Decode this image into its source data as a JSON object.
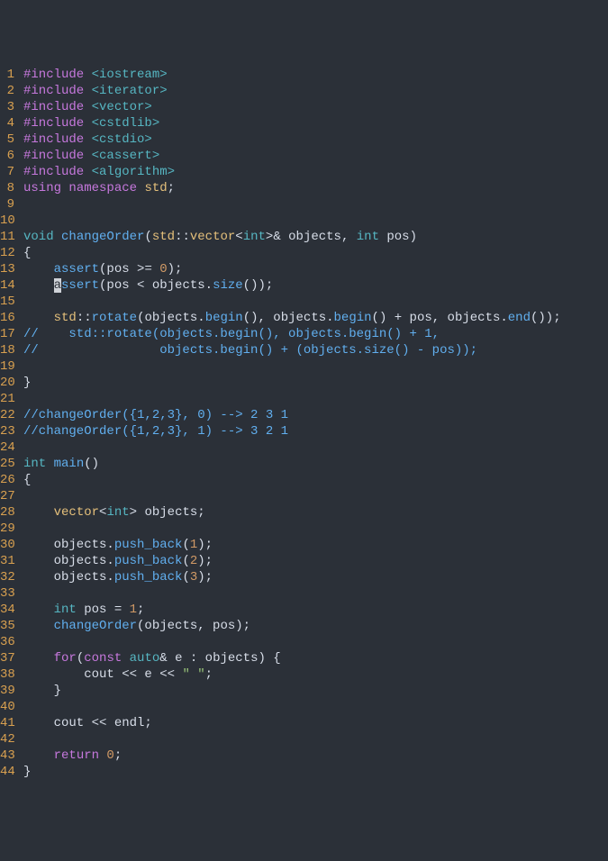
{
  "file": {
    "language": "cpp",
    "cursor": {
      "line": 14,
      "col": 5
    },
    "lines": [
      {
        "num": 1,
        "tokens": [
          {
            "t": "#include ",
            "c": "pp"
          },
          {
            "t": "<iostream>",
            "c": "inc"
          }
        ]
      },
      {
        "num": 2,
        "tokens": [
          {
            "t": "#include ",
            "c": "pp"
          },
          {
            "t": "<iterator>",
            "c": "inc"
          }
        ]
      },
      {
        "num": 3,
        "tokens": [
          {
            "t": "#include ",
            "c": "pp"
          },
          {
            "t": "<vector>",
            "c": "inc"
          }
        ]
      },
      {
        "num": 4,
        "tokens": [
          {
            "t": "#include ",
            "c": "pp"
          },
          {
            "t": "<cstdlib>",
            "c": "inc"
          }
        ]
      },
      {
        "num": 5,
        "tokens": [
          {
            "t": "#include ",
            "c": "pp"
          },
          {
            "t": "<cstdio>",
            "c": "inc"
          }
        ]
      },
      {
        "num": 6,
        "tokens": [
          {
            "t": "#include ",
            "c": "pp"
          },
          {
            "t": "<cassert>",
            "c": "inc"
          }
        ]
      },
      {
        "num": 7,
        "tokens": [
          {
            "t": "#include ",
            "c": "pp"
          },
          {
            "t": "<algorithm>",
            "c": "inc"
          }
        ]
      },
      {
        "num": 8,
        "tokens": [
          {
            "t": "using ",
            "c": "kw"
          },
          {
            "t": "namespace ",
            "c": "kw"
          },
          {
            "t": "std",
            "c": "ylw"
          },
          {
            "t": ";",
            "c": "pu"
          }
        ]
      },
      {
        "num": 9,
        "tokens": []
      },
      {
        "num": 10,
        "tokens": []
      },
      {
        "num": 11,
        "tokens": [
          {
            "t": "void ",
            "c": "ty"
          },
          {
            "t": "changeOrder",
            "c": "fn"
          },
          {
            "t": "(",
            "c": "pu"
          },
          {
            "t": "std",
            "c": "ylw"
          },
          {
            "t": "::",
            "c": "pu"
          },
          {
            "t": "vector",
            "c": "ylw"
          },
          {
            "t": "<",
            "c": "pu"
          },
          {
            "t": "int",
            "c": "ty"
          },
          {
            "t": ">& ",
            "c": "pu"
          },
          {
            "t": "objects",
            "c": "id"
          },
          {
            "t": ", ",
            "c": "pu"
          },
          {
            "t": "int ",
            "c": "ty"
          },
          {
            "t": "pos",
            "c": "id"
          },
          {
            "t": ")",
            "c": "pu"
          }
        ]
      },
      {
        "num": 12,
        "tokens": [
          {
            "t": "{",
            "c": "pu"
          }
        ]
      },
      {
        "num": 13,
        "tokens": [
          {
            "t": "    ",
            "c": "id"
          },
          {
            "t": "assert",
            "c": "fn"
          },
          {
            "t": "(pos >= ",
            "c": "id"
          },
          {
            "t": "0",
            "c": "num"
          },
          {
            "t": ");",
            "c": "pu"
          }
        ]
      },
      {
        "num": 14,
        "tokens": [
          {
            "t": "    ",
            "c": "id"
          },
          {
            "t": "a",
            "c": "cur"
          },
          {
            "t": "ssert",
            "c": "fn"
          },
          {
            "t": "(pos < objects.",
            "c": "id"
          },
          {
            "t": "size",
            "c": "fn"
          },
          {
            "t": "());",
            "c": "pu"
          }
        ]
      },
      {
        "num": 15,
        "tokens": []
      },
      {
        "num": 16,
        "tokens": [
          {
            "t": "    ",
            "c": "id"
          },
          {
            "t": "std",
            "c": "ylw"
          },
          {
            "t": "::",
            "c": "pu"
          },
          {
            "t": "rotate",
            "c": "fn"
          },
          {
            "t": "(objects.",
            "c": "id"
          },
          {
            "t": "begin",
            "c": "fn"
          },
          {
            "t": "(), objects.",
            "c": "id"
          },
          {
            "t": "begin",
            "c": "fn"
          },
          {
            "t": "() + pos, objects.",
            "c": "id"
          },
          {
            "t": "end",
            "c": "fn"
          },
          {
            "t": "());",
            "c": "pu"
          }
        ]
      },
      {
        "num": 17,
        "tokens": [
          {
            "t": "//    std::rotate(objects.begin(), objects.begin() + 1,",
            "c": "cm2"
          }
        ]
      },
      {
        "num": 18,
        "tokens": [
          {
            "t": "//                objects.begin() + (objects.size() - pos));",
            "c": "cm2"
          }
        ]
      },
      {
        "num": 19,
        "tokens": []
      },
      {
        "num": 20,
        "tokens": [
          {
            "t": "}",
            "c": "pu"
          }
        ]
      },
      {
        "num": 21,
        "tokens": []
      },
      {
        "num": 22,
        "tokens": [
          {
            "t": "//changeOrder({1,2,3}, 0) --> 2 3 1",
            "c": "cm2"
          }
        ]
      },
      {
        "num": 23,
        "tokens": [
          {
            "t": "//changeOrder({1,2,3}, 1) --> 3 2 1",
            "c": "cm2"
          }
        ]
      },
      {
        "num": 24,
        "tokens": []
      },
      {
        "num": 25,
        "tokens": [
          {
            "t": "int ",
            "c": "ty"
          },
          {
            "t": "main",
            "c": "fn"
          },
          {
            "t": "()",
            "c": "pu"
          }
        ]
      },
      {
        "num": 26,
        "tokens": [
          {
            "t": "{",
            "c": "pu"
          }
        ]
      },
      {
        "num": 27,
        "tokens": []
      },
      {
        "num": 28,
        "tokens": [
          {
            "t": "    ",
            "c": "id"
          },
          {
            "t": "vector",
            "c": "ylw"
          },
          {
            "t": "<",
            "c": "pu"
          },
          {
            "t": "int",
            "c": "ty"
          },
          {
            "t": "> objects;",
            "c": "id"
          }
        ]
      },
      {
        "num": 29,
        "tokens": []
      },
      {
        "num": 30,
        "tokens": [
          {
            "t": "    objects.",
            "c": "id"
          },
          {
            "t": "push_back",
            "c": "fn"
          },
          {
            "t": "(",
            "c": "pu"
          },
          {
            "t": "1",
            "c": "num"
          },
          {
            "t": ");",
            "c": "pu"
          }
        ]
      },
      {
        "num": 31,
        "tokens": [
          {
            "t": "    objects.",
            "c": "id"
          },
          {
            "t": "push_back",
            "c": "fn"
          },
          {
            "t": "(",
            "c": "pu"
          },
          {
            "t": "2",
            "c": "num"
          },
          {
            "t": ");",
            "c": "pu"
          }
        ]
      },
      {
        "num": 32,
        "tokens": [
          {
            "t": "    objects.",
            "c": "id"
          },
          {
            "t": "push_back",
            "c": "fn"
          },
          {
            "t": "(",
            "c": "pu"
          },
          {
            "t": "3",
            "c": "num"
          },
          {
            "t": ");",
            "c": "pu"
          }
        ]
      },
      {
        "num": 33,
        "tokens": []
      },
      {
        "num": 34,
        "tokens": [
          {
            "t": "    ",
            "c": "id"
          },
          {
            "t": "int ",
            "c": "ty"
          },
          {
            "t": "pos = ",
            "c": "id"
          },
          {
            "t": "1",
            "c": "num"
          },
          {
            "t": ";",
            "c": "pu"
          }
        ]
      },
      {
        "num": 35,
        "tokens": [
          {
            "t": "    ",
            "c": "id"
          },
          {
            "t": "changeOrder",
            "c": "fn"
          },
          {
            "t": "(objects, pos);",
            "c": "id"
          }
        ]
      },
      {
        "num": 36,
        "tokens": []
      },
      {
        "num": 37,
        "tokens": [
          {
            "t": "    ",
            "c": "id"
          },
          {
            "t": "for",
            "c": "kw"
          },
          {
            "t": "(",
            "c": "pu"
          },
          {
            "t": "const ",
            "c": "kw"
          },
          {
            "t": "auto",
            "c": "ty"
          },
          {
            "t": "& e : objects) {",
            "c": "id"
          }
        ]
      },
      {
        "num": 38,
        "tokens": [
          {
            "t": "        cout << e << ",
            "c": "id"
          },
          {
            "t": "\" \"",
            "c": "str"
          },
          {
            "t": ";",
            "c": "pu"
          }
        ]
      },
      {
        "num": 39,
        "tokens": [
          {
            "t": "    }",
            "c": "id"
          }
        ]
      },
      {
        "num": 40,
        "tokens": []
      },
      {
        "num": 41,
        "tokens": [
          {
            "t": "    cout << endl;",
            "c": "id"
          }
        ]
      },
      {
        "num": 42,
        "tokens": []
      },
      {
        "num": 43,
        "tokens": [
          {
            "t": "    ",
            "c": "id"
          },
          {
            "t": "return ",
            "c": "kw"
          },
          {
            "t": "0",
            "c": "num"
          },
          {
            "t": ";",
            "c": "pu"
          }
        ]
      },
      {
        "num": 44,
        "tokens": [
          {
            "t": "}",
            "c": "pu"
          }
        ]
      }
    ]
  }
}
